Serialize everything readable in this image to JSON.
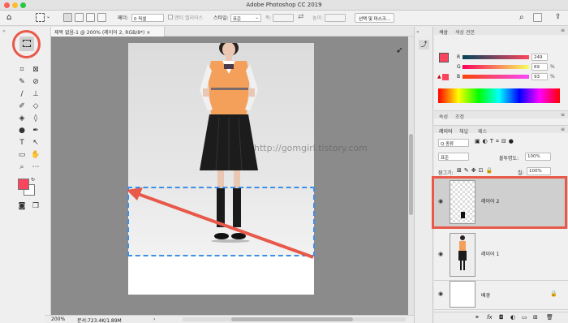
{
  "app_title": "Adobe Photoshop CC 2019",
  "options_bar": {
    "feather_label": "페더:",
    "feather_value": "0 픽셀",
    "antialias_label": "앤티 앨리어스",
    "style_label": "스타일:",
    "style_value": "표준",
    "width_label": "폭:",
    "height_label": "높이:",
    "select_mask_button": "선택 및 마스크..."
  },
  "document_tab": {
    "label": "제목 없음-1 @ 200% (레이어 2, RGB/8*)",
    "close": "×"
  },
  "watermark": "http://gomgirl.tistory.com",
  "status_bar": {
    "zoom": "200%",
    "doc_info": "문서:723.4K/1.89M",
    "arrow": "›"
  },
  "color_panel": {
    "tab_color": "색상",
    "tab_swatches": "색상 견본",
    "r_label": "R",
    "g_label": "G",
    "b_label": "B",
    "r_value": "249",
    "g_value": "69",
    "b_value": "93",
    "unit": "%",
    "foreground_color": "#f9455d"
  },
  "properties_tabs": {
    "tab_properties": "속성",
    "tab_adjust": "조정"
  },
  "layers_panel": {
    "tab_layers": "레이어",
    "tab_channels": "채널",
    "tab_paths": "패스",
    "filter_label": "Q 종류",
    "blend_mode": "표준",
    "opacity_label": "불투명도:",
    "opacity_value": "100%",
    "lock_label": "잠그기:",
    "fill_label": "칠:",
    "fill_value": "100%",
    "layers": [
      {
        "name": "레이어 2"
      },
      {
        "name": "레이어 1"
      },
      {
        "name": "배경"
      }
    ]
  },
  "colors": {
    "highlight_red": "#e8594a",
    "selection_blue": "#3d8fe8",
    "arrow_red": "#e8594a"
  }
}
